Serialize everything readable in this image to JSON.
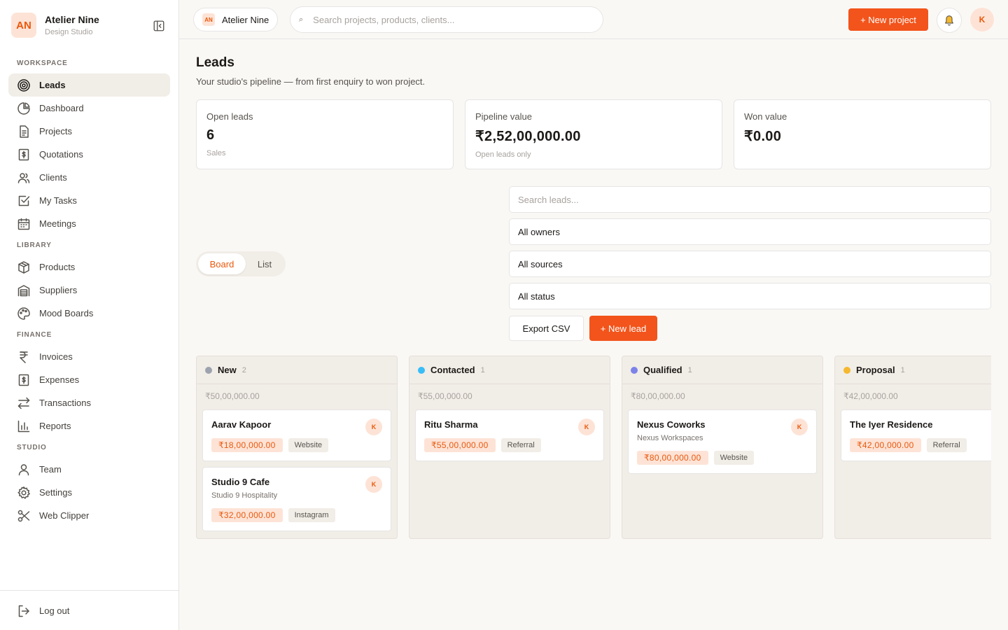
{
  "brand": {
    "initials": "AN",
    "name": "Atelier Nine",
    "subtitle": "Design Studio"
  },
  "sidebar": {
    "sections": [
      {
        "label": "WORKSPACE",
        "items": [
          {
            "label": "Leads",
            "icon": "target-icon",
            "active": true
          },
          {
            "label": "Dashboard",
            "icon": "pie-chart-icon"
          },
          {
            "label": "Projects",
            "icon": "document-icon"
          },
          {
            "label": "Quotations",
            "icon": "dollar-doc-icon"
          },
          {
            "label": "Clients",
            "icon": "users-icon"
          },
          {
            "label": "My Tasks",
            "icon": "checkbox-icon"
          },
          {
            "label": "Meetings",
            "icon": "calendar-icon"
          }
        ]
      },
      {
        "label": "LIBRARY",
        "items": [
          {
            "label": "Products",
            "icon": "box-icon"
          },
          {
            "label": "Suppliers",
            "icon": "warehouse-icon"
          },
          {
            "label": "Mood Boards",
            "icon": "palette-icon"
          }
        ]
      },
      {
        "label": "FINANCE",
        "items": [
          {
            "label": "Invoices",
            "icon": "rupee-icon"
          },
          {
            "label": "Expenses",
            "icon": "dollar-doc-icon"
          },
          {
            "label": "Transactions",
            "icon": "arrows-icon"
          },
          {
            "label": "Reports",
            "icon": "bar-chart-icon"
          }
        ]
      },
      {
        "label": "STUDIO",
        "items": [
          {
            "label": "Team",
            "icon": "user-icon"
          },
          {
            "label": "Settings",
            "icon": "gear-icon"
          },
          {
            "label": "Web Clipper",
            "icon": "scissors-icon"
          }
        ]
      }
    ],
    "logout": "Log out"
  },
  "topbar": {
    "workspace_initials": "AN",
    "workspace_name": "Atelier Nine",
    "search_placeholder": "Search projects, products, clients...",
    "new_project": "+  New project",
    "user_initial": "K"
  },
  "page": {
    "title": "Leads",
    "subtitle": "Your studio's pipeline — from first enquiry to won project."
  },
  "stats": [
    {
      "label": "Open leads",
      "value": "6",
      "note": "Sales"
    },
    {
      "label": "Pipeline value",
      "value": "₹2,52,00,000.00",
      "note": "Open leads only"
    },
    {
      "label": "Won value",
      "value": "₹0.00",
      "note": ""
    }
  ],
  "view_toggle": {
    "board": "Board",
    "list": "List",
    "selected": "Board"
  },
  "filters": {
    "search_placeholder": "Search leads...",
    "owner": "All owners",
    "source": "All sources",
    "status": "All status",
    "export": "Export CSV",
    "new_lead": "+ New lead"
  },
  "colors": {
    "accent": "#f2541b",
    "new": "#9ca3af",
    "contacted": "#38bdf8",
    "qualified": "#7c83e8",
    "proposal": "#f5b82e"
  },
  "columns": [
    {
      "name": "New",
      "count": "2",
      "total": "₹50,00,000.00",
      "color": "#9ca3af",
      "cards": [
        {
          "name": "Aarav Kapoor",
          "company": "",
          "amount": "₹18,00,000.00",
          "source": "Website",
          "owner": "K"
        },
        {
          "name": "Studio 9 Cafe",
          "company": "Studio 9 Hospitality",
          "amount": "₹32,00,000.00",
          "source": "Instagram",
          "owner": "K"
        }
      ]
    },
    {
      "name": "Contacted",
      "count": "1",
      "total": "₹55,00,000.00",
      "color": "#38bdf8",
      "cards": [
        {
          "name": "Ritu Sharma",
          "company": "",
          "amount": "₹55,00,000.00",
          "source": "Referral",
          "owner": "K"
        }
      ]
    },
    {
      "name": "Qualified",
      "count": "1",
      "total": "₹80,00,000.00",
      "color": "#7c83e8",
      "cards": [
        {
          "name": "Nexus Coworks",
          "company": "Nexus Workspaces",
          "amount": "₹80,00,000.00",
          "source": "Website",
          "owner": "K"
        }
      ]
    },
    {
      "name": "Proposal",
      "count": "1",
      "total": "₹42,00,000.00",
      "color": "#f5b82e",
      "cards": [
        {
          "name": "The Iyer Residence",
          "company": "",
          "amount": "₹42,00,000.00",
          "source": "Referral",
          "owner": ""
        }
      ]
    }
  ]
}
